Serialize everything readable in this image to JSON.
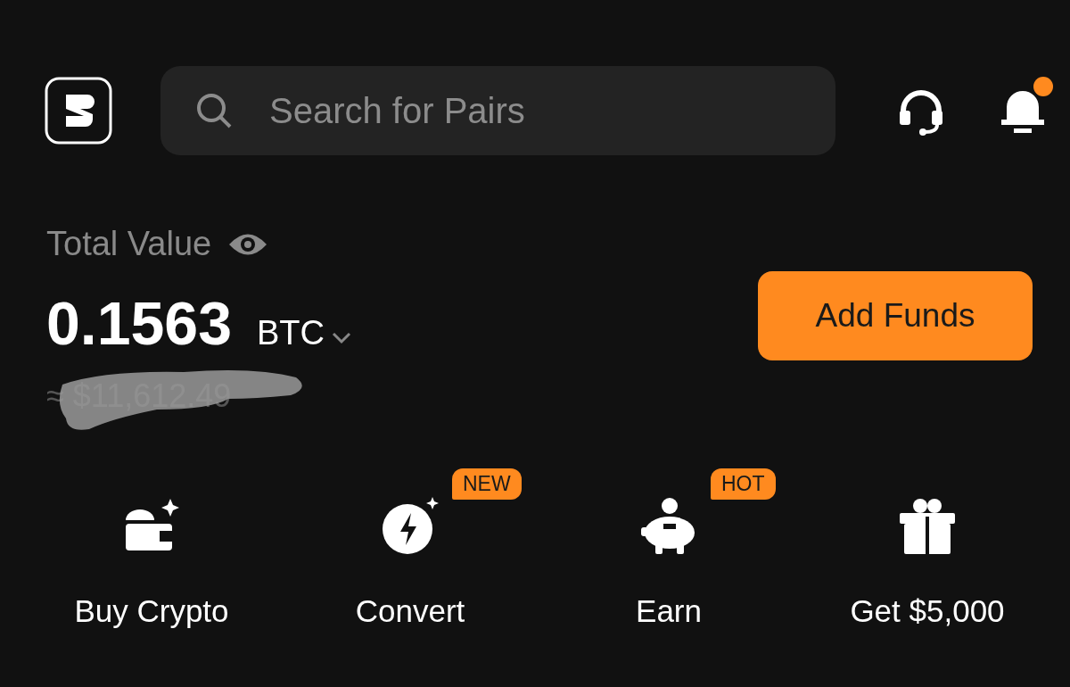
{
  "search": {
    "placeholder": "Search for Pairs"
  },
  "notifications": {
    "unread": true
  },
  "balance": {
    "label": "Total Value",
    "amount": "0.1563",
    "currency": "BTC",
    "fiat": "≈ $11,612.49",
    "hidden_by_scribble": true
  },
  "add_funds": "Add Funds",
  "actions": [
    {
      "kind": "buy",
      "label": "Buy Crypto"
    },
    {
      "kind": "convert",
      "label": "Convert",
      "badge": "NEW"
    },
    {
      "kind": "earn",
      "label": "Earn",
      "badge": "HOT"
    },
    {
      "kind": "gift",
      "label": "Get $5,000"
    }
  ]
}
